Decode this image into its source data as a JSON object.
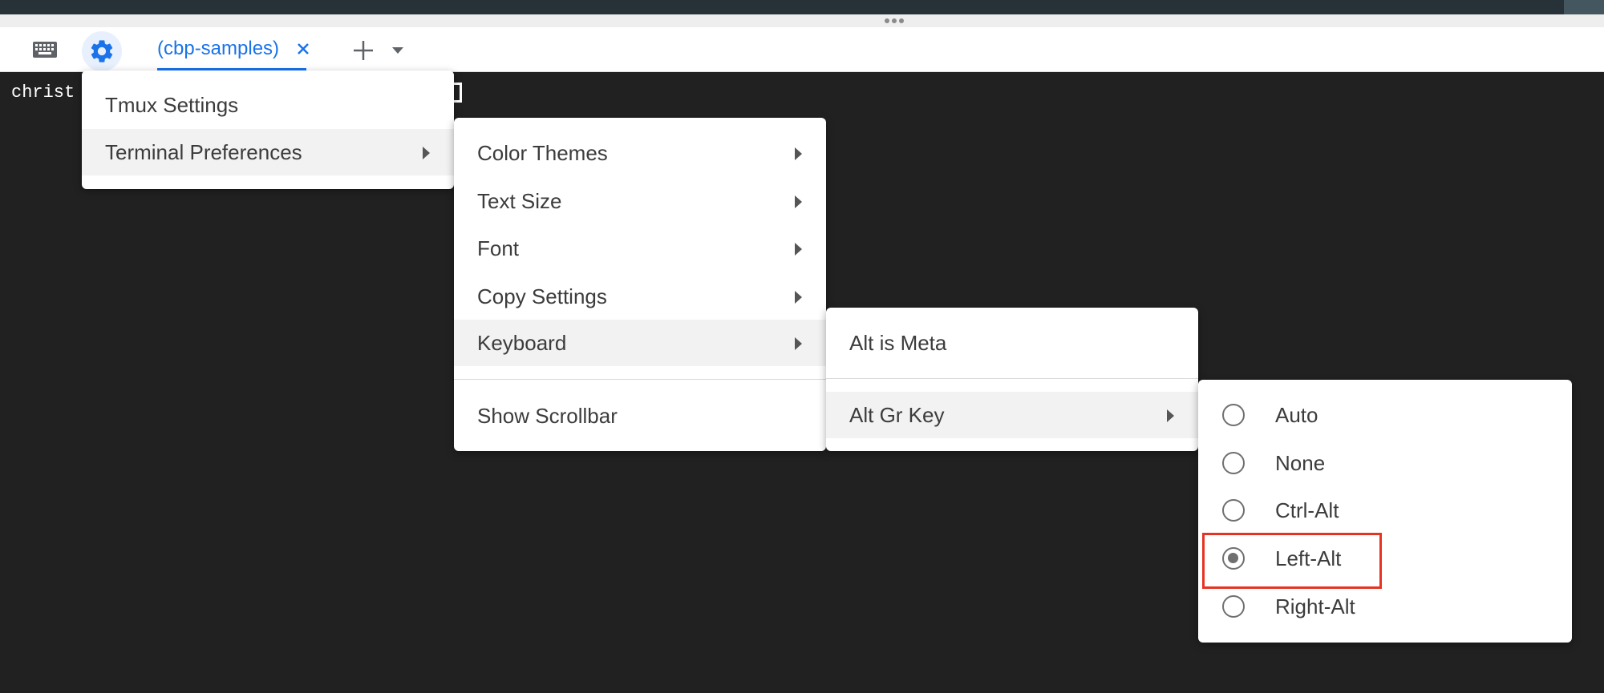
{
  "colors": {
    "accent": "#1a73e8",
    "terminal_bg": "#212121",
    "highlight": "#e53424"
  },
  "toolbar": {
    "keyboard_icon": "keyboard-icon",
    "settings_icon": "gear-icon",
    "tab": {
      "label": "(cbp-samples)",
      "close_icon": "close-icon"
    },
    "add_icon": "plus-icon",
    "dropdown_icon": "caret-down-icon"
  },
  "terminal": {
    "text": "christ"
  },
  "menu_main": {
    "items": [
      {
        "label": "Tmux Settings"
      },
      {
        "label": "Terminal Preferences",
        "has_submenu": true,
        "active": true
      }
    ]
  },
  "menu_prefs": {
    "items": [
      {
        "label": "Color Themes",
        "has_submenu": true
      },
      {
        "label": "Text Size",
        "has_submenu": true
      },
      {
        "label": "Font",
        "has_submenu": true
      },
      {
        "label": "Copy Settings",
        "has_submenu": true
      },
      {
        "label": "Keyboard",
        "has_submenu": true,
        "active": true
      },
      {
        "label": "Show Scrollbar"
      }
    ]
  },
  "menu_keyboard": {
    "items": [
      {
        "label": "Alt is Meta"
      },
      {
        "label": "Alt Gr Key",
        "has_submenu": true,
        "active": true
      }
    ]
  },
  "menu_altgr": {
    "selected": "Left-Alt",
    "options": [
      {
        "label": "Auto"
      },
      {
        "label": "None"
      },
      {
        "label": "Ctrl-Alt"
      },
      {
        "label": "Left-Alt"
      },
      {
        "label": "Right-Alt"
      }
    ]
  }
}
